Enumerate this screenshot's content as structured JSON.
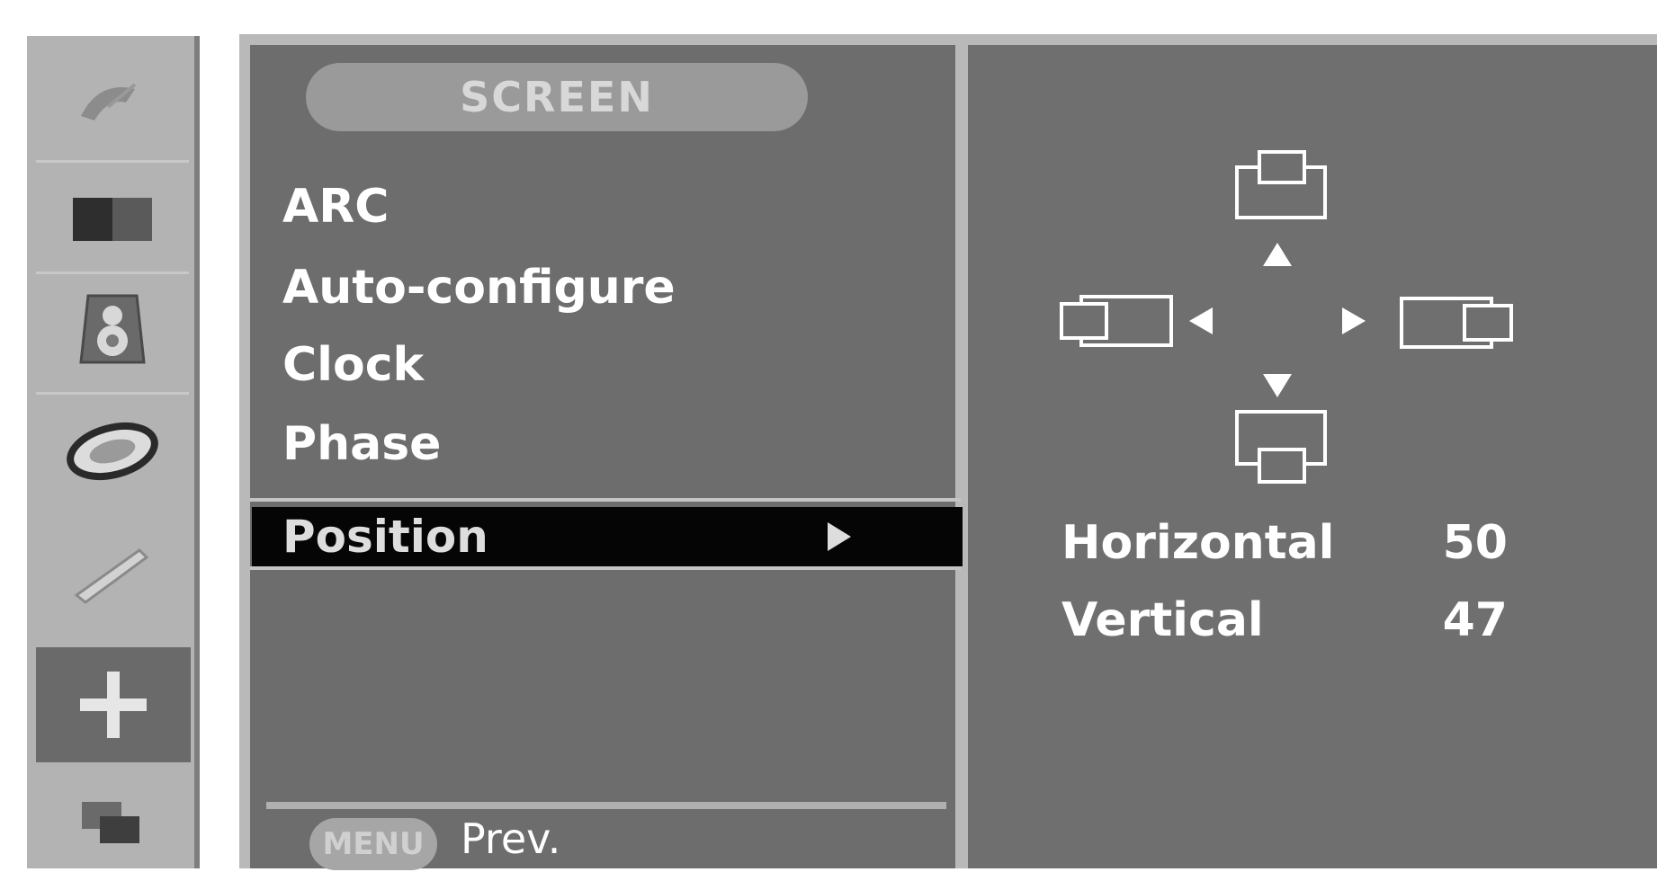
{
  "sidebar": {
    "items": [
      {
        "icon": "satellite-dish-icon"
      },
      {
        "icon": "picture-icon"
      },
      {
        "icon": "sound-speaker-icon"
      },
      {
        "icon": "time-dial-icon"
      },
      {
        "icon": "special-tool-icon"
      },
      {
        "icon": "screen-position-cross-icon",
        "active": true
      },
      {
        "icon": "pip-window-icon"
      }
    ]
  },
  "menu": {
    "title": "SCREEN",
    "items": [
      "ARC",
      "Auto-configure",
      "Clock",
      "Phase"
    ],
    "selected": "Position"
  },
  "footer": {
    "menu_button": "MENU",
    "prev_label": "Prev."
  },
  "position": {
    "horizontal_label": "Horizontal",
    "horizontal_value": "50",
    "vertical_label": "Vertical",
    "vertical_value": "47"
  },
  "colors": {
    "panel_bg": "#6d6d6d",
    "frame": "#b9b9b9",
    "sidebar_bg": "#b3b3b3",
    "selected_bar": "#050505",
    "text": "#ffffff"
  }
}
